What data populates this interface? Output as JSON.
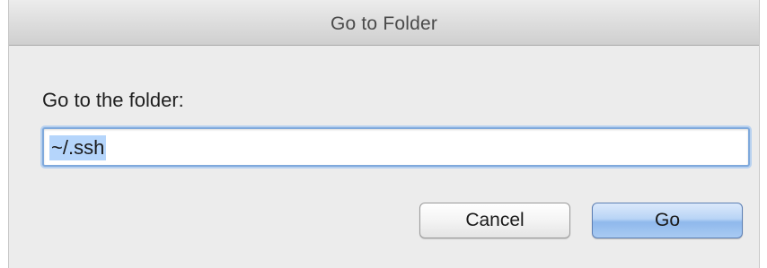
{
  "dialog": {
    "title": "Go to Folder",
    "prompt_label": "Go to the folder:",
    "path_input": {
      "value": "~/.ssh",
      "selected": true
    },
    "buttons": {
      "cancel_label": "Cancel",
      "go_label": "Go"
    }
  },
  "colors": {
    "selection_highlight": "#b5d5fb",
    "focus_ring": "#7fa9dc",
    "default_button": "#a9cbf3"
  }
}
